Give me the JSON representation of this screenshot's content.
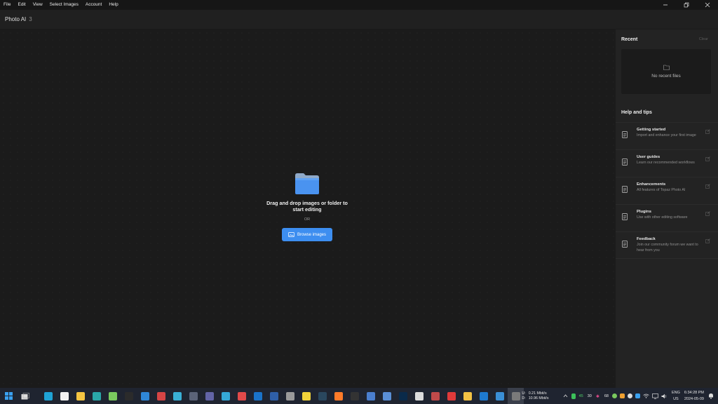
{
  "menu": [
    "File",
    "Edit",
    "View",
    "Select Images",
    "Account",
    "Help"
  ],
  "window_controls": [
    "minimize-icon",
    "restore-icon",
    "close-icon"
  ],
  "app": {
    "name": "Photo AI",
    "version": "3"
  },
  "drop": {
    "title": "Drag and drop images or folder to start editing",
    "or": "OR",
    "browse_label": "Browse images",
    "accent": "#3d8ef0",
    "folder_color": "#4a93f0"
  },
  "panel": {
    "recent_title": "Recent",
    "clear_label": "Clear",
    "no_recent": "No recent files",
    "help_title": "Help and tips",
    "help_items": [
      {
        "title": "Getting started",
        "desc": "Import and enhance your first image"
      },
      {
        "title": "User guides",
        "desc": "Learn our recommended workflows"
      },
      {
        "title": "Enhancements",
        "desc": "All features of Topaz Photo AI"
      },
      {
        "title": "Plugins",
        "desc": "Use with other editing software"
      },
      {
        "title": "Feedback",
        "desc": "Join our community forum we want to hear from you"
      }
    ]
  },
  "taskbar": {
    "apps": [
      {
        "name": "edge-icon",
        "color": "#1fa3d6"
      },
      {
        "name": "store-icon",
        "color": "#f2f2f2"
      },
      {
        "name": "weather-icon",
        "color": "#f5c542"
      },
      {
        "name": "app-teal-icon",
        "color": "#2aa7a8"
      },
      {
        "name": "notepad-icon",
        "color": "#7ac95e"
      },
      {
        "name": "terminal-icon",
        "color": "#2b2b2b"
      },
      {
        "name": "photos-icon",
        "color": "#2f87d8"
      },
      {
        "name": "snipping-icon",
        "color": "#d64545"
      },
      {
        "name": "notes-icon",
        "color": "#3ab0d6"
      },
      {
        "name": "calculator-icon",
        "color": "#5b6378"
      },
      {
        "name": "teams-icon",
        "color": "#6264a7"
      },
      {
        "name": "dolphin-icon",
        "color": "#35a8d6"
      },
      {
        "name": "app-red-blue-icon",
        "color": "#e04a4a"
      },
      {
        "name": "outlook-icon",
        "color": "#1a73c9"
      },
      {
        "name": "powershell-icon",
        "color": "#2f5fa8"
      },
      {
        "name": "app-phone-icon",
        "color": "#9a9a9a"
      },
      {
        "name": "app-triangle-icon",
        "color": "#f0d23a"
      },
      {
        "name": "steam-icon",
        "color": "#2a475e"
      },
      {
        "name": "firefox-icon",
        "color": "#ff7b29"
      },
      {
        "name": "app-dark-icon",
        "color": "#333333"
      },
      {
        "name": "app-globe-icon",
        "color": "#4a7fd0"
      },
      {
        "name": "app-pc-icon",
        "color": "#5a8fd6"
      },
      {
        "name": "photoshop-icon",
        "color": "#0a2a4a"
      },
      {
        "name": "unity-icon",
        "color": "#dcdcdc"
      },
      {
        "name": "davinci-icon",
        "color": "#c04a4a"
      },
      {
        "name": "app-star-icon",
        "color": "#e03a3a"
      },
      {
        "name": "folder-icon",
        "color": "#f3c244"
      },
      {
        "name": "app-vscode-icon",
        "color": "#1e7ad0"
      },
      {
        "name": "app-monitor-icon",
        "color": "#3a8fd6"
      },
      {
        "name": "topaz-icon",
        "color": "#7a7a7a"
      }
    ],
    "network": {
      "up_label": "U:",
      "down_label": "D:",
      "up": "0.21 Mbit/s",
      "down": "10.96 Mbit/s"
    },
    "tray_nums": [
      "45",
      "30",
      "68"
    ],
    "lang_top": "ENG",
    "lang_bottom": "US",
    "time": "6:34:28 PM",
    "date": "2024-05-09"
  }
}
